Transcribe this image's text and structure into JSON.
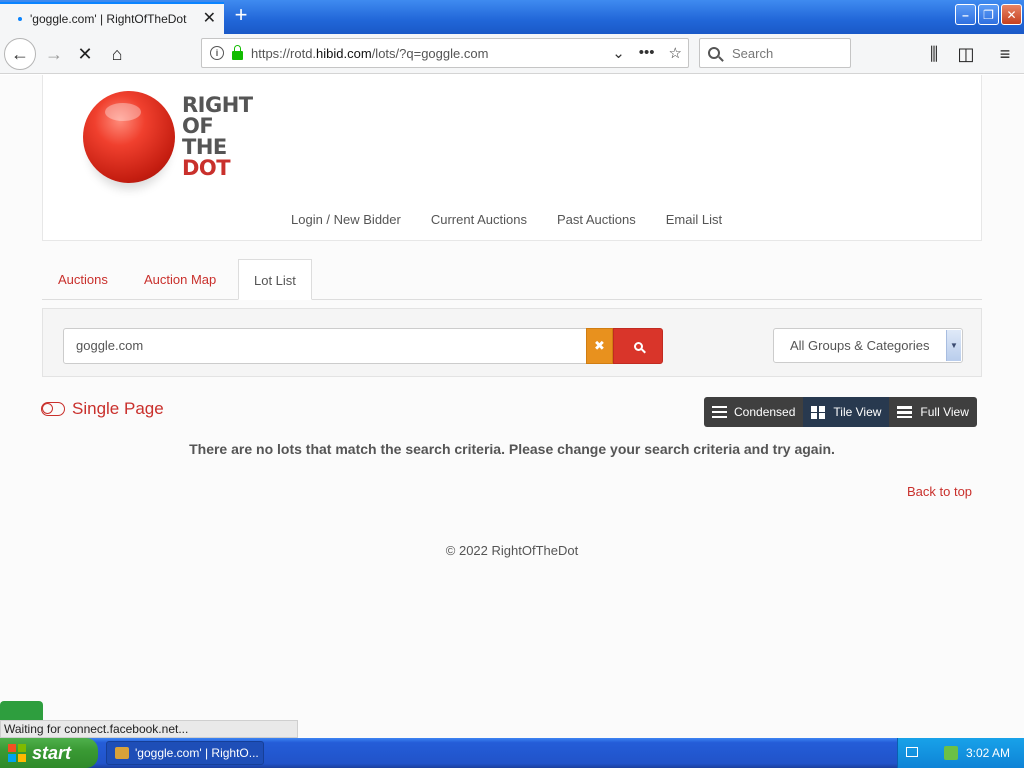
{
  "browser": {
    "tab_title": "'goggle.com' | RightOfTheDot",
    "url_prefix": "https://rotd.",
    "url_domain": "hibid.com",
    "url_path": "/lots/?q=goggle.com",
    "search_placeholder": "Search"
  },
  "site": {
    "logo_lines": [
      "RIGHT",
      "OF",
      "THE",
      "DOT"
    ],
    "nav": [
      "Login / New Bidder",
      "Current Auctions",
      "Past Auctions",
      "Email List"
    ],
    "tabs": [
      "Auctions",
      "Auction Map",
      "Lot List"
    ],
    "active_tab": "Lot List",
    "search_value": "goggle.com",
    "category_selected": "All Groups & Categories",
    "single_page_label": "Single Page",
    "views": [
      "Condensed",
      "Tile View",
      "Full View"
    ],
    "active_view": "Tile View",
    "no_results": "There are no lots that match the search criteria. Please change your search criteria and try again.",
    "back_to_top": "Back to top",
    "copyright": "© 2022 RightOfTheDot"
  },
  "status": {
    "text": "Waiting for connect.facebook.net..."
  },
  "taskbar": {
    "start_label": "start",
    "item_label": "'goggle.com' | RightO...",
    "time": "3:02 AM"
  },
  "colors": {
    "accent": "#c9302c",
    "clear_button": "#e8911e",
    "search_button": "#d9352a"
  }
}
